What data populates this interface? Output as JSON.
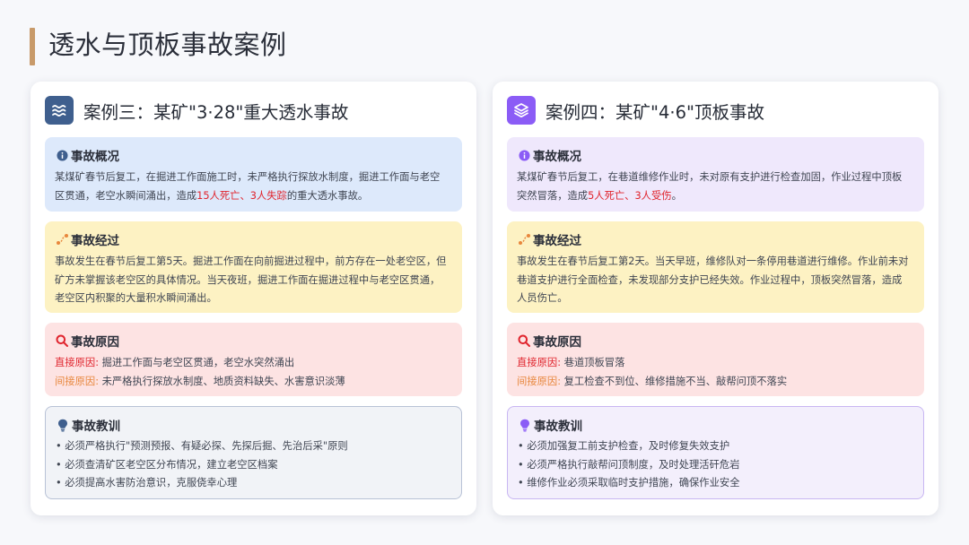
{
  "page": {
    "title": "透水与顶板事故案例"
  },
  "colors": {
    "accent_bar": "#c89a6a",
    "left_badge": "#3f5f8e",
    "right_badge": "#8b5cf6",
    "highlight_red": "#e0242d",
    "indirect_orange": "#e8873d"
  },
  "left": {
    "icon": "water-waves-icon",
    "title": "案例三：某矿\"3·28\"重大透水事故",
    "overview": {
      "heading": "事故概况",
      "icon": "info-icon",
      "line1": "某煤矿春节后复工，在掘进工作面施工时，未严格执行探放水制度，掘进工作面与老空",
      "line2_pre": "区贯通，老空水瞬间涌出，造成",
      "line2_red": "15人死亡、3人失踪",
      "line2_post": "的重大透水事故。"
    },
    "process": {
      "heading": "事故经过",
      "icon": "route-icon",
      "lines": [
        "事故发生在春节后复工第5天。掘进工作面在向前掘进过程中，前方存在一处老空区，但",
        "矿方未掌握该老空区的具体情况。当天夜班，掘进工作面在掘进过程中与老空区贯通，",
        "老空区内积聚的大量积水瞬间涌出。"
      ]
    },
    "cause": {
      "heading": "事故原因",
      "icon": "magnifier-icon",
      "direct_label": "直接原因:",
      "direct_text": " 掘进工作面与老空区贯通，老空水突然涌出",
      "indirect_label": "间接原因:",
      "indirect_text": " 未严格执行探放水制度、地质资料缺失、水害意识淡薄"
    },
    "lesson": {
      "heading": "事故教训",
      "icon": "lightbulb-icon",
      "items": [
        "• 必须严格执行\"预测预报、有疑必探、先探后掘、先治后采\"原则",
        "• 必须查清矿区老空区分布情况，建立老空区档案",
        "• 必须提高水害防治意识，克服侥幸心理"
      ]
    }
  },
  "right": {
    "icon": "layers-icon",
    "title": "案例四：某矿\"4·6\"顶板事故",
    "overview": {
      "heading": "事故概况",
      "icon": "info-icon",
      "line1": "某煤矿春节后复工，在巷道维修作业时，未对原有支护进行检查加固，作业过程中顶板",
      "line2_pre": "突然冒落，造成",
      "line2_red": "5人死亡、3人受伤",
      "line2_post": "。"
    },
    "process": {
      "heading": "事故经过",
      "icon": "route-icon",
      "lines": [
        "事故发生在春节后复工第2天。当天早班，维修队对一条停用巷道进行维修。作业前未对",
        "巷道支护进行全面检查，未发现部分支护已经失效。作业过程中，顶板突然冒落，造成",
        "人员伤亡。"
      ]
    },
    "cause": {
      "heading": "事故原因",
      "icon": "magnifier-icon",
      "direct_label": "直接原因:",
      "direct_text": " 巷道顶板冒落",
      "indirect_label": "间接原因:",
      "indirect_text": " 复工检查不到位、维修措施不当、敲帮问顶不落实"
    },
    "lesson": {
      "heading": "事故教训",
      "icon": "lightbulb-icon",
      "items": [
        "• 必须加强复工前支护检查，及时修复失效支护",
        "• 必须严格执行敲帮问顶制度，及时处理活矸危岩",
        "• 维修作业必须采取临时支护措施，确保作业安全"
      ]
    }
  }
}
